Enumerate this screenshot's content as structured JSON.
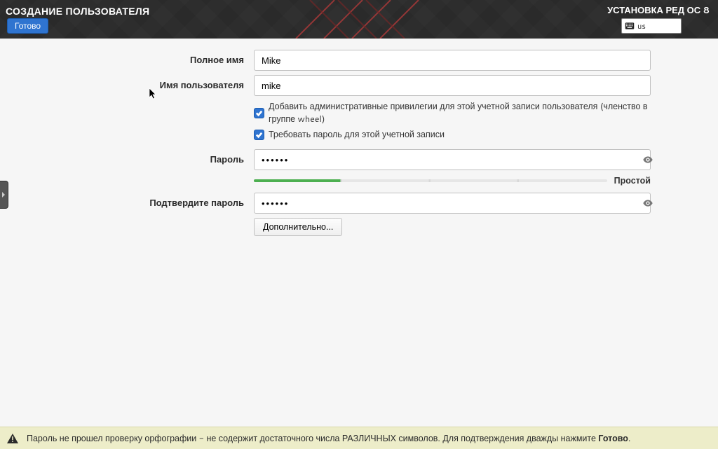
{
  "header": {
    "title_left": "СОЗДАНИЕ ПОЛЬЗОВАТЕЛЯ",
    "title_right": "УСТАНОВКА РЕД ОС 8",
    "done_label": "Готово",
    "keyboard_layout": "us"
  },
  "form": {
    "fullname_label": "Полное имя",
    "fullname_value": "Mike",
    "username_label": "Имя пользователя",
    "username_value": "mike",
    "checkbox_admin": "Добавить административные привилегии для этой учетной записи пользователя (членство в группе wheel)",
    "checkbox_require_pw": "Требовать пароль для этой учетной записи",
    "password_label": "Пароль",
    "password_value": "••••••",
    "password_strength_label": "Простой",
    "confirm_label": "Подтвердите пароль",
    "confirm_value": "••••••",
    "advanced_label": "Дополнительно..."
  },
  "footer": {
    "message_prefix": "Пароль не прошел проверку орфографии - не содержит достаточного числа РАЗЛИЧНЫХ символов. Для подтверждения дважды нажмите ",
    "message_bold": "Готово",
    "message_suffix": "."
  }
}
